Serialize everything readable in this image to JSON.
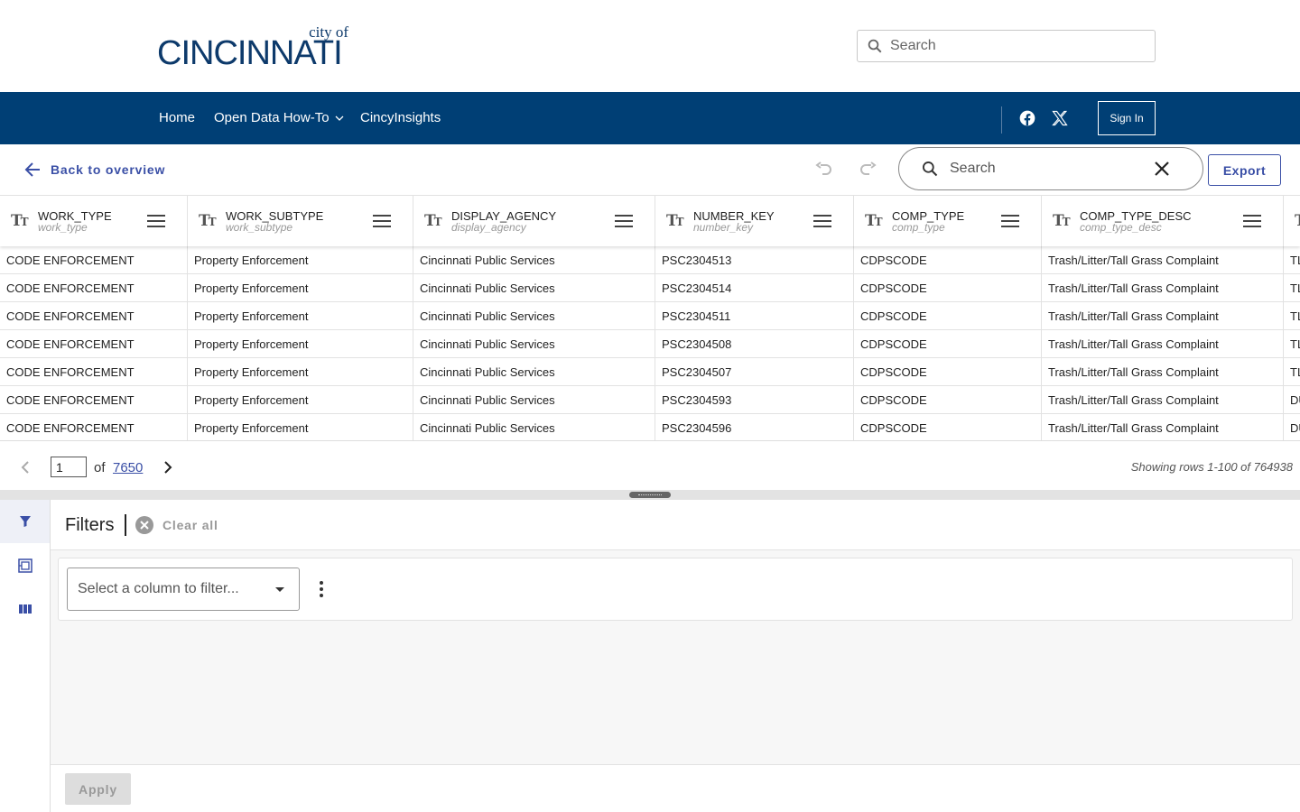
{
  "header": {
    "logo_small": "city of",
    "logo_main": "CINCINNATI",
    "search_placeholder": "Search"
  },
  "nav": {
    "items": [
      {
        "label": "Home"
      },
      {
        "label": "Open Data How-To"
      },
      {
        "label": "CincyInsights"
      }
    ],
    "social_icons": [
      "facebook-icon",
      "x-icon"
    ],
    "signin_label": "Sign In"
  },
  "toolbar": {
    "back_label": "Back to overview",
    "search_placeholder": "Search",
    "export_label": "Export"
  },
  "table": {
    "columns": [
      {
        "name": "WORK_TYPE",
        "field": "work_type"
      },
      {
        "name": "WORK_SUBTYPE",
        "field": "work_subtype"
      },
      {
        "name": "DISPLAY_AGENCY",
        "field": "display_agency"
      },
      {
        "name": "NUMBER_KEY",
        "field": "number_key"
      },
      {
        "name": "COMP_TYPE",
        "field": "comp_type"
      },
      {
        "name": "COMP_TYPE_DESC",
        "field": "comp_type_desc"
      },
      {
        "name": "",
        "field": ""
      }
    ],
    "rows": [
      [
        "CODE ENFORCEMENT",
        "Property Enforcement",
        "Cincinnati Public Services",
        "PSC2304513",
        "CDPSCODE",
        "Trash/Litter/Tall Grass Complaint",
        "TL"
      ],
      [
        "CODE ENFORCEMENT",
        "Property Enforcement",
        "Cincinnati Public Services",
        "PSC2304514",
        "CDPSCODE",
        "Trash/Litter/Tall Grass Complaint",
        "TL"
      ],
      [
        "CODE ENFORCEMENT",
        "Property Enforcement",
        "Cincinnati Public Services",
        "PSC2304511",
        "CDPSCODE",
        "Trash/Litter/Tall Grass Complaint",
        "TL"
      ],
      [
        "CODE ENFORCEMENT",
        "Property Enforcement",
        "Cincinnati Public Services",
        "PSC2304508",
        "CDPSCODE",
        "Trash/Litter/Tall Grass Complaint",
        "TL"
      ],
      [
        "CODE ENFORCEMENT",
        "Property Enforcement",
        "Cincinnati Public Services",
        "PSC2304507",
        "CDPSCODE",
        "Trash/Litter/Tall Grass Complaint",
        "TL"
      ],
      [
        "CODE ENFORCEMENT",
        "Property Enforcement",
        "Cincinnati Public Services",
        "PSC2304593",
        "CDPSCODE",
        "Trash/Litter/Tall Grass Complaint",
        "DU"
      ],
      [
        "CODE ENFORCEMENT",
        "Property Enforcement",
        "Cincinnati Public Services",
        "PSC2304596",
        "CDPSCODE",
        "Trash/Litter/Tall Grass Complaint",
        "DU"
      ]
    ]
  },
  "pagination": {
    "current_page": "1",
    "of_label": "of",
    "total_pages": "7650",
    "showing_text": "Showing rows 1-100 of 764938"
  },
  "filters": {
    "title": "Filters",
    "clear_all_label": "Clear all",
    "select_placeholder": "Select a column to filter...",
    "apply_label": "Apply"
  },
  "colors": {
    "nav_bg": "#003f75",
    "accent": "#3a4fa6",
    "logo": "#0d3a6b"
  }
}
